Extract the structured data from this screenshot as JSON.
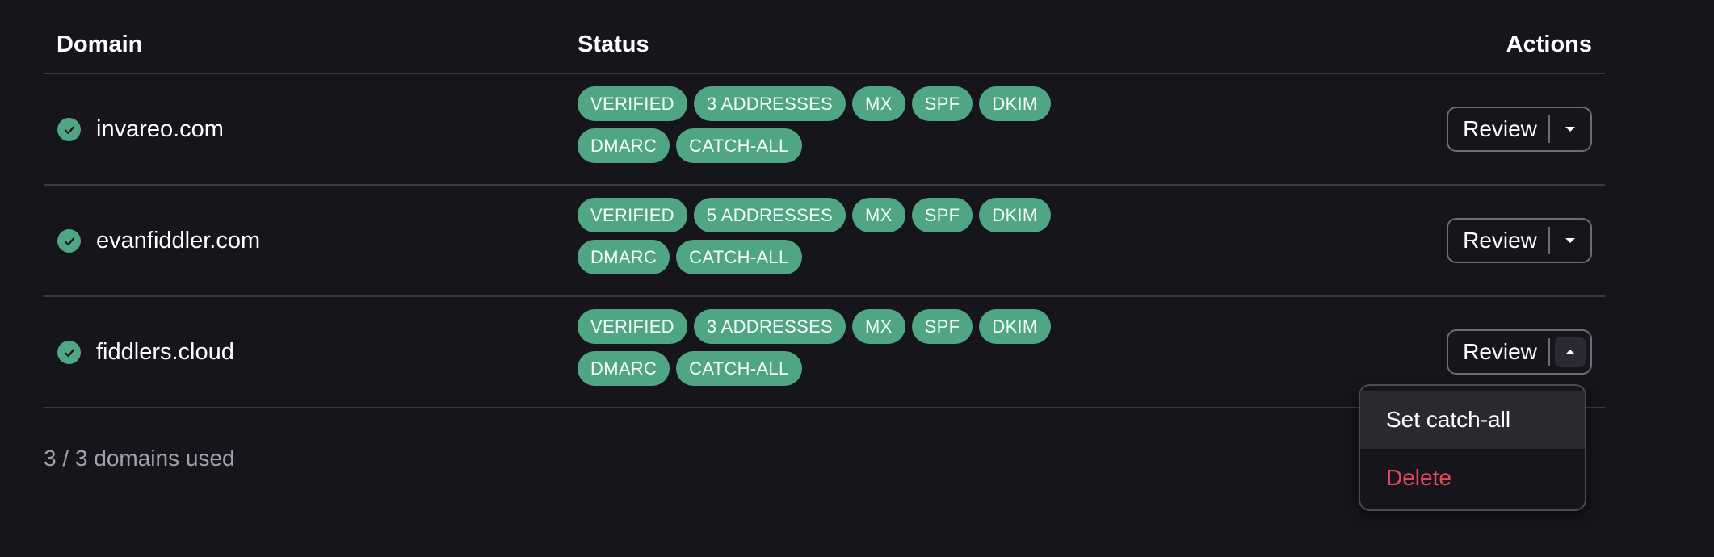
{
  "table": {
    "headers": {
      "domain": "Domain",
      "status": "Status",
      "actions": "Actions"
    },
    "rows": [
      {
        "domain": "invareo.com",
        "badges": [
          "VERIFIED",
          "3 ADDRESSES",
          "MX",
          "SPF",
          "DKIM",
          "DMARC",
          "CATCH-ALL"
        ],
        "action_label": "Review",
        "menu_open": false
      },
      {
        "domain": "evanfiddler.com",
        "badges": [
          "VERIFIED",
          "5 ADDRESSES",
          "MX",
          "SPF",
          "DKIM",
          "DMARC",
          "CATCH-ALL"
        ],
        "action_label": "Review",
        "menu_open": false
      },
      {
        "domain": "fiddlers.cloud",
        "badges": [
          "VERIFIED",
          "3 ADDRESSES",
          "MX",
          "SPF",
          "DKIM",
          "DMARC",
          "CATCH-ALL"
        ],
        "action_label": "Review",
        "menu_open": true
      }
    ]
  },
  "footer": {
    "usage": "3 / 3 domains used"
  },
  "dropdown": {
    "items": [
      {
        "label": "Set catch-all",
        "variant": "highlighted"
      },
      {
        "label": "Delete",
        "variant": "danger"
      }
    ]
  },
  "colors": {
    "background": "#16151b",
    "badge": "#4fa584",
    "danger": "#e5485d",
    "border": "#3b3a42"
  },
  "icons": {
    "verified": "check-circle-icon",
    "dropdown_closed": "caret-down-icon",
    "dropdown_open": "caret-up-icon"
  }
}
